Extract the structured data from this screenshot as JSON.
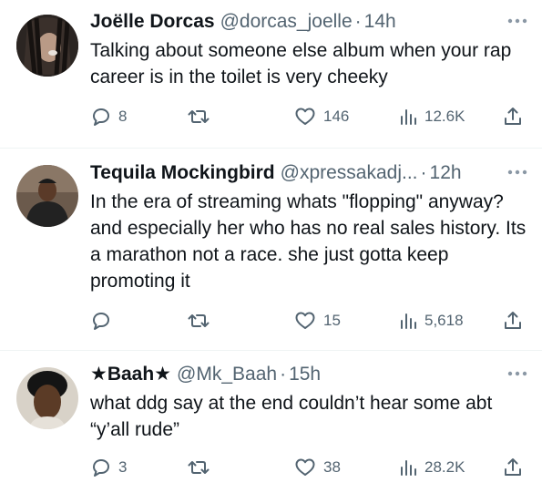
{
  "tweets": [
    {
      "name": "Joëlle Dorcas",
      "handle": "@dorcas_joelle",
      "time": "14h",
      "text": "Talking about someone else album when your rap career is in the toilet is very cheeky",
      "replies": "8",
      "retweets": "",
      "likes": "146",
      "views": "12.6K"
    },
    {
      "name": "Tequila Mockingbird",
      "handle": "@xpressakadj...",
      "time": "12h",
      "text": "In the era of streaming whats \"flopping\" anyway? and especially her who has no real sales history. Its a marathon not a race. she just gotta keep promoting it",
      "replies": "",
      "retweets": "",
      "likes": "15",
      "views": "5,618"
    },
    {
      "name": "★Baah★",
      "handle": "@Mk_Baah",
      "time": "15h",
      "text": "what ddg say at the end couldn’t hear some abt “y’all rude”",
      "replies": "3",
      "retweets": "",
      "likes": "38",
      "views": "28.2K"
    }
  ],
  "separator": "·",
  "icons": {
    "reply": "reply-icon",
    "retweet": "retweet-icon",
    "like": "heart-icon",
    "views": "views-icon",
    "share": "share-icon",
    "more": "more-icon"
  },
  "colors": {
    "text": "#0f1419",
    "secondary": "#536471",
    "divider": "#eff3f4"
  }
}
